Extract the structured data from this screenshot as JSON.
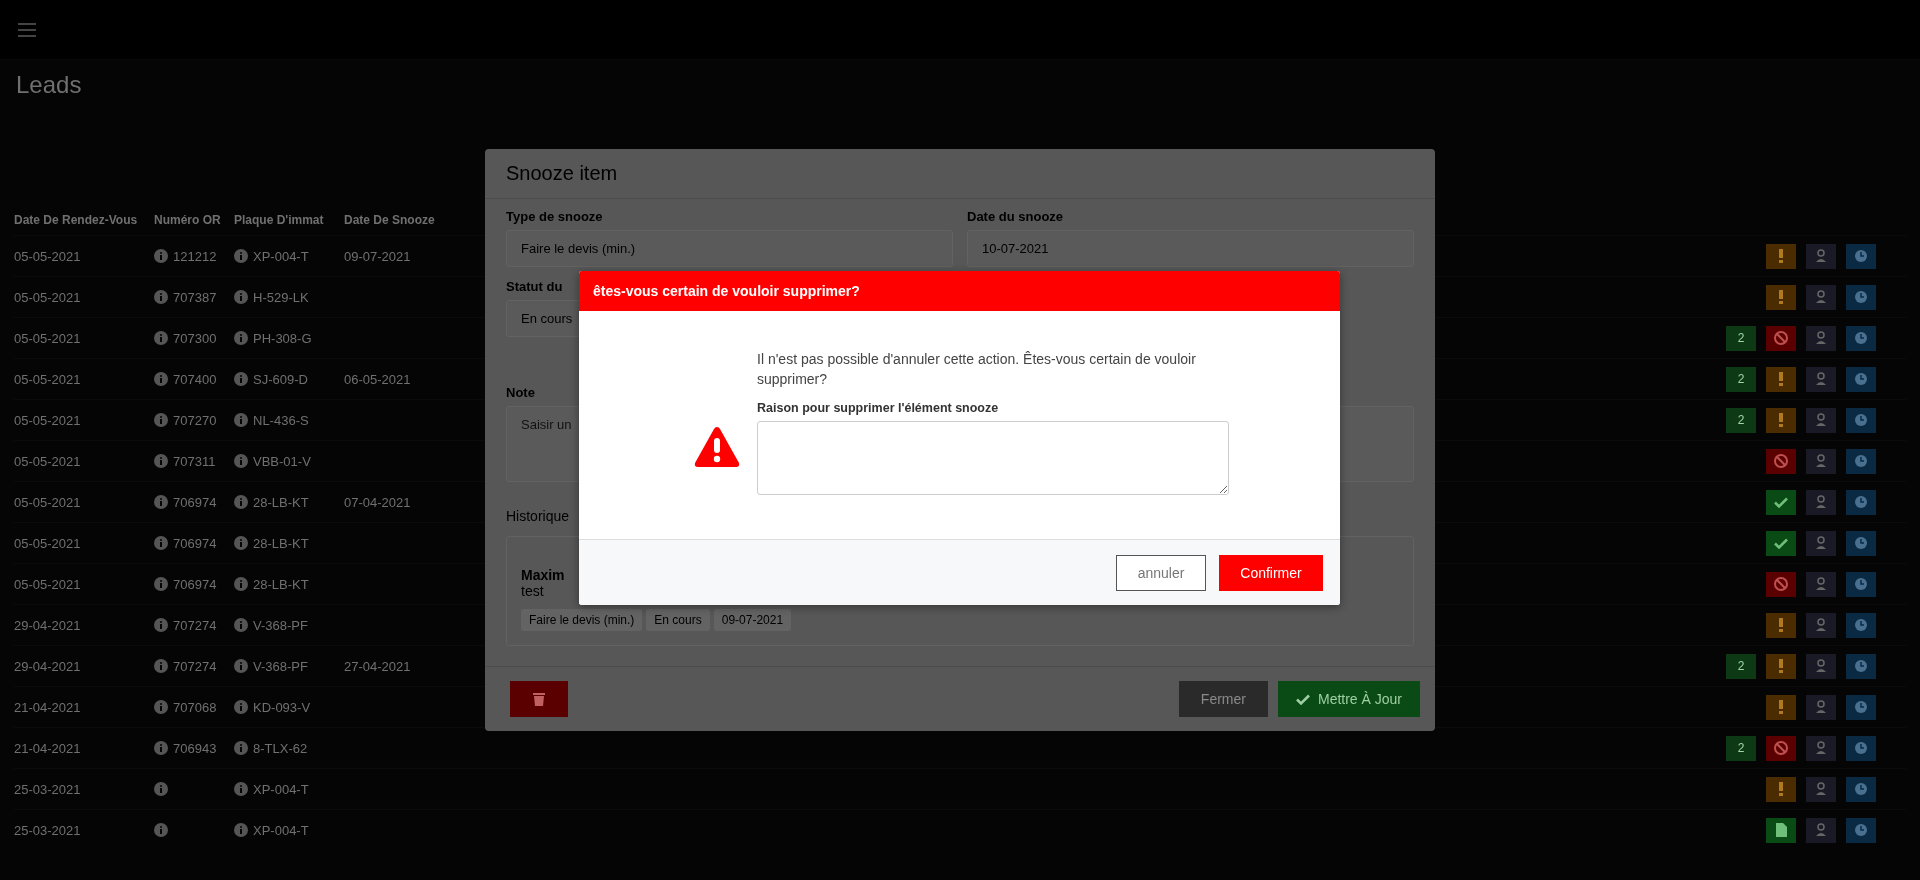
{
  "page": {
    "title": "Leads"
  },
  "table": {
    "columns": [
      "Date De Rendez-Vous",
      "Numéro OR",
      "Plaque D'immat",
      "Date De Snooze"
    ],
    "rows": [
      {
        "date": "05-05-2021",
        "order": "121212",
        "plate": "XP-004-T",
        "snooze": "09-07-2021",
        "kind": "pending"
      },
      {
        "date": "05-05-2021",
        "order": "707387",
        "plate": "H-529-LK",
        "kind": "pending"
      },
      {
        "date": "05-05-2021",
        "order": "707300",
        "plate": "PH-308-G",
        "badge": "2",
        "kind": "rejected"
      },
      {
        "date": "05-05-2021",
        "order": "707400",
        "plate": "SJ-609-D",
        "snooze": "06-05-2021",
        "badge": "2",
        "kind": "pending"
      },
      {
        "date": "05-05-2021",
        "order": "707270",
        "plate": "NL-436-S",
        "badge": "2",
        "kind": "pending"
      },
      {
        "date": "05-05-2021",
        "order": "707311",
        "plate": "VBB-01-V",
        "kind": "rejected"
      },
      {
        "date": "05-05-2021",
        "order": "706974",
        "plate": "28-LB-KT",
        "snooze": "07-04-2021",
        "kind": "approved"
      },
      {
        "date": "05-05-2021",
        "order": "706974",
        "plate": "28-LB-KT",
        "kind": "approved"
      },
      {
        "date": "05-05-2021",
        "order": "706974",
        "plate": "28-LB-KT",
        "kind": "rejected"
      },
      {
        "date": "29-04-2021",
        "order": "707274",
        "plate": "V-368-PF",
        "kind": "pending"
      },
      {
        "date": "29-04-2021",
        "order": "707274",
        "plate": "V-368-PF",
        "snooze": "27-04-2021",
        "badge": "2",
        "kind": "pending"
      },
      {
        "date": "21-04-2021",
        "order": "707068",
        "plate": "KD-093-V",
        "kind": "pending"
      },
      {
        "date": "21-04-2021",
        "order": "706943",
        "plate": "8-TLX-62",
        "badge": "2",
        "kind": "rejected"
      },
      {
        "date": "25-03-2021",
        "plate": "XP-004-T",
        "kind": "pending"
      },
      {
        "date": "25-03-2021",
        "plate": "XP-004-T",
        "kind": "document"
      }
    ]
  },
  "snooze_modal": {
    "title": "Snooze item",
    "fields": [
      {
        "label": "Type de snooze",
        "value": "Faire le devis (min.)"
      },
      {
        "label": "Date du snooze",
        "value": "10-07-2021"
      },
      {
        "label": "Statut du",
        "value": "En cours"
      }
    ],
    "note": {
      "label": "Note",
      "placeholder": "Saisir un"
    },
    "history": {
      "label": "Historique",
      "author": "Maxim",
      "text": "test",
      "chips": [
        "Faire le devis (min.)",
        "En cours",
        "09-07-2021"
      ]
    },
    "buttons": {
      "close": "Fermer",
      "update": "Mettre À Jour"
    }
  },
  "confirm_dialog": {
    "title": "êtes-vous certain de vouloir supprimer?",
    "message": "Il n'est pas possible d'annuler cette action. Êtes-vous certain de vouloir supprimer?",
    "reason_label": "Raison pour supprimer l'élément snooze",
    "cancel": "annuler",
    "confirm": "Confirmer"
  }
}
